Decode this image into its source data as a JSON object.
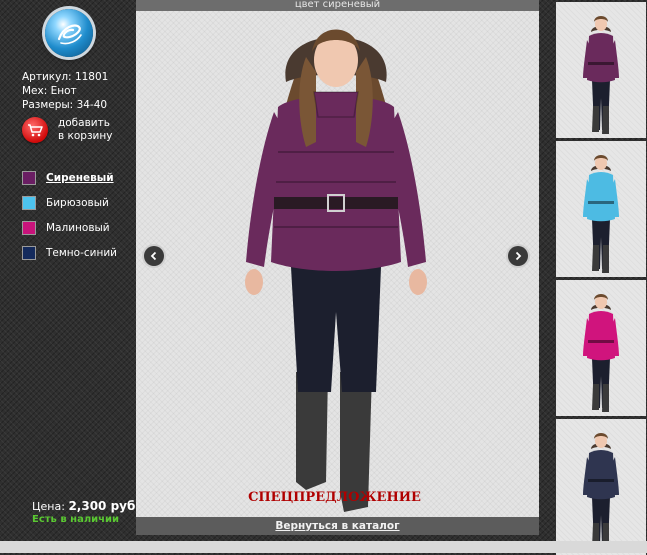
{
  "product": {
    "sku_label": "Артикул:",
    "sku_value": "11801",
    "fur_label": "Мех:",
    "fur_value": "Енот",
    "sizes_label": "Размеры:",
    "sizes_value": "34-40",
    "cart_line1": "добавить",
    "cart_line2": "в корзину",
    "price_label": "Цена:",
    "price_value": "2,300 руб.",
    "stock": "Есть в наличии"
  },
  "colors": [
    {
      "label": "Сиреневый",
      "hex": "#6a1e63",
      "selected": true
    },
    {
      "label": "Бирюзовый",
      "hex": "#4dc3ee",
      "selected": false
    },
    {
      "label": "Малиновый",
      "hex": "#c8137b",
      "selected": false
    },
    {
      "label": "Темно-синий",
      "hex": "#142a5c",
      "selected": false
    }
  ],
  "viewer": {
    "caption": "цвет сиреневый",
    "special": "СПЕЦПРЕДЛОЖЕНИЕ",
    "back_link": "Вернуться в каталог",
    "current_jacket_hex": "#6a2a5c"
  },
  "thumbnails": [
    {
      "color_name": "Сиреневый",
      "jacket_hex": "#6a2a5c"
    },
    {
      "color_name": "Бирюзовый",
      "jacket_hex": "#4dbbe3"
    },
    {
      "color_name": "Малиновый",
      "jacket_hex": "#d0147d"
    },
    {
      "color_name": "Темно-синий",
      "jacket_hex": "#2f3550"
    }
  ],
  "icons": {
    "logo": "logo-icon",
    "cart": "cart-icon",
    "prev": "arrow-left-icon",
    "next": "arrow-right-icon"
  }
}
